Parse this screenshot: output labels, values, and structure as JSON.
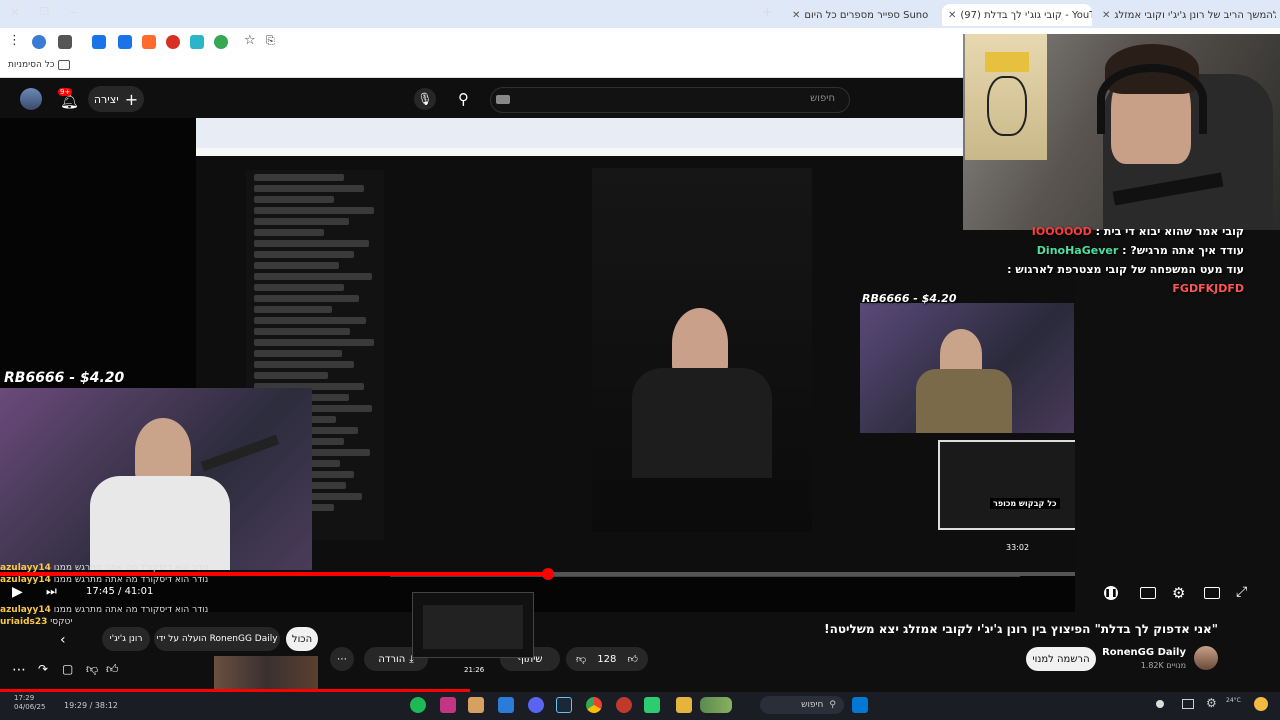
{
  "browser": {
    "tabs": [
      {
        "title": "לא שוב | עודד מגיב להמשך הריב של רונן ג'יג'י וקובי אמזלג DISS",
        "active": false
      },
      {
        "title": "(97) קובי גוג'י לך בדלת - YouTube",
        "active": true
      },
      {
        "title": "ספייר מספרים כל היום Suno",
        "active": false
      }
    ],
    "bookmarks_label": "כל הסימניות"
  },
  "youtube": {
    "search_placeholder": "חיפוש",
    "create_label": "יצירה",
    "notif_count": "9+",
    "video": {
      "donation_left": "RB6666 - $4.20",
      "donation_right": "RB6666 - $4.20",
      "mini_thumb_caption": "כל קבקוש מכופר",
      "mini_time": "33:02"
    },
    "overlay_chat": [
      {
        "user": "IOOOOOD",
        "message": "קובי אמר שהוא יבוא די בית",
        "color": "#ff3b3b"
      },
      {
        "user": "DinoHaGever",
        "message": "עודד איך אתה מרגיש?",
        "color": "#4fe0a0"
      },
      {
        "user": "FGDFKJDFD",
        "message": "עוד מעט המשפחה של קובי מצטרפת לארגוש",
        "color": "#ff5555"
      }
    ],
    "left_chat": [
      {
        "user": "azulayy14",
        "message": "נודר הוא דיסקורד מה אתה מתרגש ממנו"
      },
      {
        "user": "azulayy14",
        "message": "נודר הוא דיסקורד מה אתה מתרגש ממנו"
      },
      {
        "user": "azulayy14",
        "message": "נודר הוא דיסקורד מה אתה מתרגש ממנו"
      },
      {
        "user": "uriaids23",
        "message": "יטקסי"
      }
    ],
    "player": {
      "time_current": "17:45",
      "time_total": "41:01",
      "progress": 0.51
    },
    "title": "\"אני אדפוק לך בדלת\" הפיצוץ בין רונן ג'יג'י לקובי אמזלג יצא משליטה!",
    "channel": {
      "name": "RonenGG Daily",
      "subs": "1.82K מנויים",
      "subscribe_label": "הרשמה למנוי"
    },
    "actions": {
      "likes": "128",
      "share": "שיתוף",
      "download": "הורדה"
    },
    "chips": {
      "all": "הכול",
      "uploaded_by": "הועלה על ידי RonenGG Daily",
      "ronen": "רונן ג'יג'י"
    },
    "mini_player_time": "21:26",
    "mini_player_timeline": "19:29 / 38:12"
  },
  "taskbar": {
    "search_label": "חיפוש",
    "clock_time": "17:29",
    "clock_date": "04/06/25",
    "weather": "24°C"
  },
  "colors": {
    "accent": "#ff0000",
    "background": "#0f0f0f"
  }
}
